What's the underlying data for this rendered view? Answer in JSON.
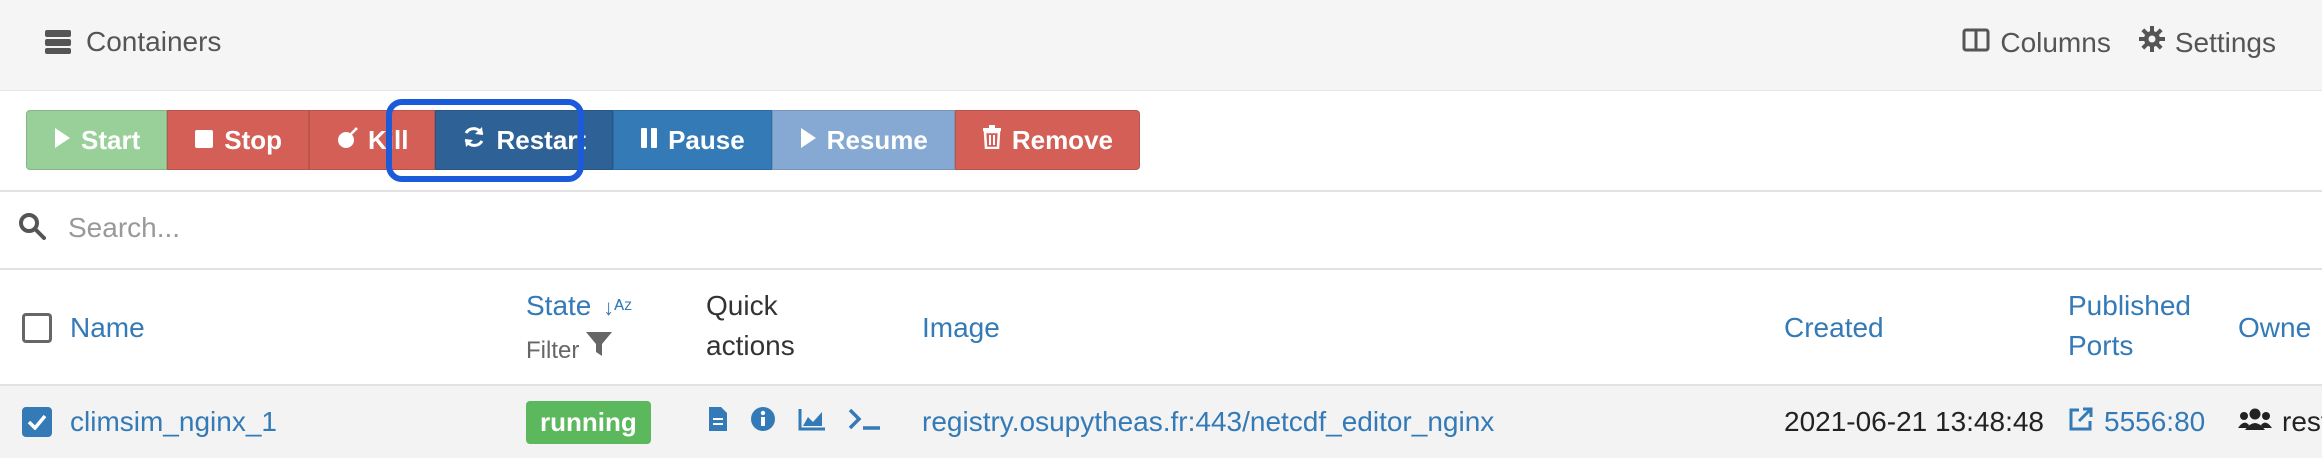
{
  "header": {
    "title": "Containers",
    "columns_label": "Columns",
    "settings_label": "Settings"
  },
  "toolbar": {
    "start": "Start",
    "stop": "Stop",
    "kill": "Kill",
    "restart": "Restart",
    "pause": "Pause",
    "resume": "Resume",
    "remove": "Remove"
  },
  "search": {
    "placeholder": "Search..."
  },
  "table": {
    "headers": {
      "name": "Name",
      "state": "State",
      "state_filter": "Filter",
      "quick_actions_1": "Quick",
      "quick_actions_2": "actions",
      "image": "Image",
      "created": "Created",
      "published_ports_1": "Published",
      "published_ports_2": "Ports",
      "owner": "Owne"
    },
    "rows": [
      {
        "name": "climsim_nginx_1",
        "state": "running",
        "image": "registry.osupytheas.fr:443/netcdf_editor_nginx",
        "created": "2021-06-21 13:48:48",
        "port": "5556:80",
        "owner": "rest"
      }
    ]
  },
  "colors": {
    "primary": "#337ab7",
    "success": "#5cb85c",
    "danger": "#d35f56",
    "highlight": "#1b5ad8"
  }
}
